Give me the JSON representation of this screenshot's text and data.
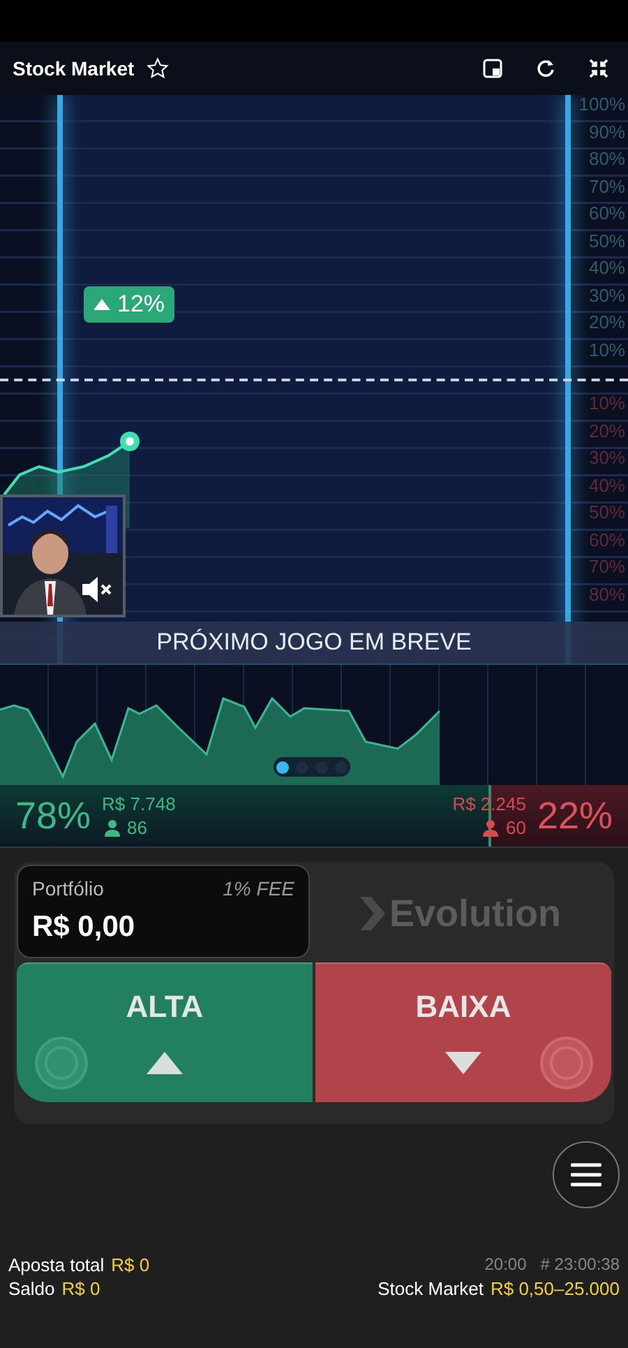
{
  "header": {
    "title": "Stock Market",
    "favorite": false
  },
  "chart": {
    "badge": "12%",
    "scale_up": [
      "100%",
      "90%",
      "80%",
      "70%",
      "60%",
      "50%",
      "40%",
      "30%",
      "20%",
      "10%"
    ],
    "scale_down": [
      "10%",
      "20%",
      "30%",
      "40%",
      "50%",
      "60%",
      "70%",
      "80%"
    ],
    "banner": "PRÓXIMO JOGO EM BREVE",
    "video": {
      "muted": true
    }
  },
  "carousel": {
    "dots": [
      {
        "selected": true
      },
      {
        "selected": false
      },
      {
        "selected": false
      },
      {
        "selected": false
      }
    ]
  },
  "stats": {
    "level": 0.78,
    "up": {
      "percent": "78%",
      "amount": "R$ 7.748",
      "players": "86"
    },
    "down": {
      "percent": "22%",
      "amount": "R$ 2.245",
      "players": "60"
    }
  },
  "portfolio": {
    "label": "Portfólio",
    "fee": "1% FEE",
    "value": "R$ 0,00"
  },
  "logo": "Evolution",
  "bets": [
    {
      "kind": "up",
      "label": "ALTA"
    },
    {
      "kind": "down",
      "label": "BAIXA"
    }
  ],
  "footer": {
    "total_label": "Aposta total",
    "total": "R$ 0",
    "balance_label": "Saldo",
    "balance": "R$ 0",
    "time": "20:00",
    "round": "# 23:00:38",
    "table": "Stock Market",
    "limits": "R$ 0,50–25.000"
  }
}
